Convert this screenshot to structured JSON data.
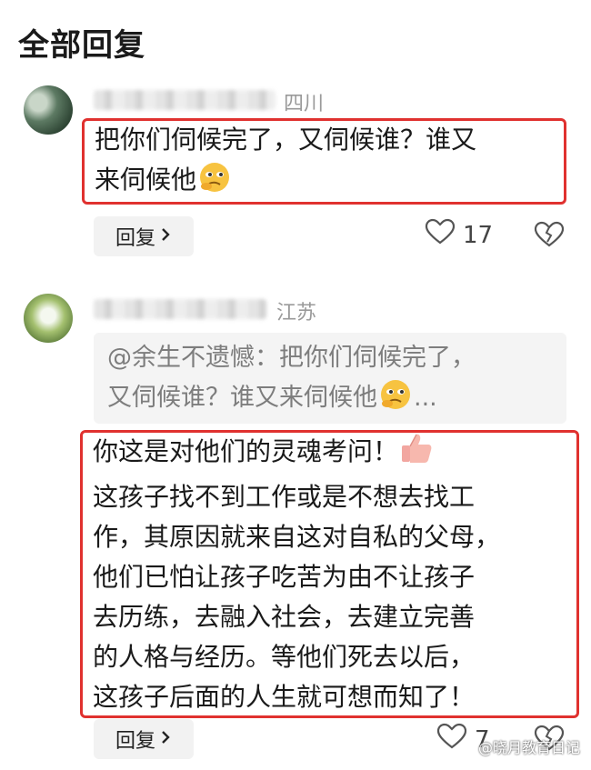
{
  "page": {
    "title": "全部回复"
  },
  "comments": [
    {
      "region": "四川",
      "text_line1": "把你们伺候完了，又伺候谁？谁又",
      "text_line2": "来伺候他",
      "reply_label": "回复",
      "like_count": "17"
    },
    {
      "region": "江苏",
      "quote_line1": "@余生不遗憾：把你们伺候完了，",
      "quote_line2": "又伺候谁？谁又来伺候他",
      "quote_ellipsis": "...",
      "lines": [
        "你这是对他们的灵魂考问！",
        "这孩子找不到工作或是不想去找工",
        "作，其原因就来自这对自私的父母，",
        "他们已怕让孩子吃苦为由不让孩子",
        "去历练，去融入社会，去建立完善",
        "的人格与经历。等他们死去以后，",
        "这孩子后面的人生就可想而知了！"
      ],
      "reply_label": "回复",
      "like_count": "7"
    }
  ],
  "watermark": "@晓月教育日记",
  "icons": {
    "chevron": "chevron-right-icon",
    "like": "heart-outline-icon",
    "dislike": "broken-heart-icon",
    "thinking_emoji": "thinking-face-emoji",
    "thumbs_up_emoji": "thumbs-up-emoji"
  },
  "colors": {
    "highlight_border": "#e0312f",
    "region_text": "#9a9a9a",
    "quote_bg": "#f4f4f4"
  }
}
